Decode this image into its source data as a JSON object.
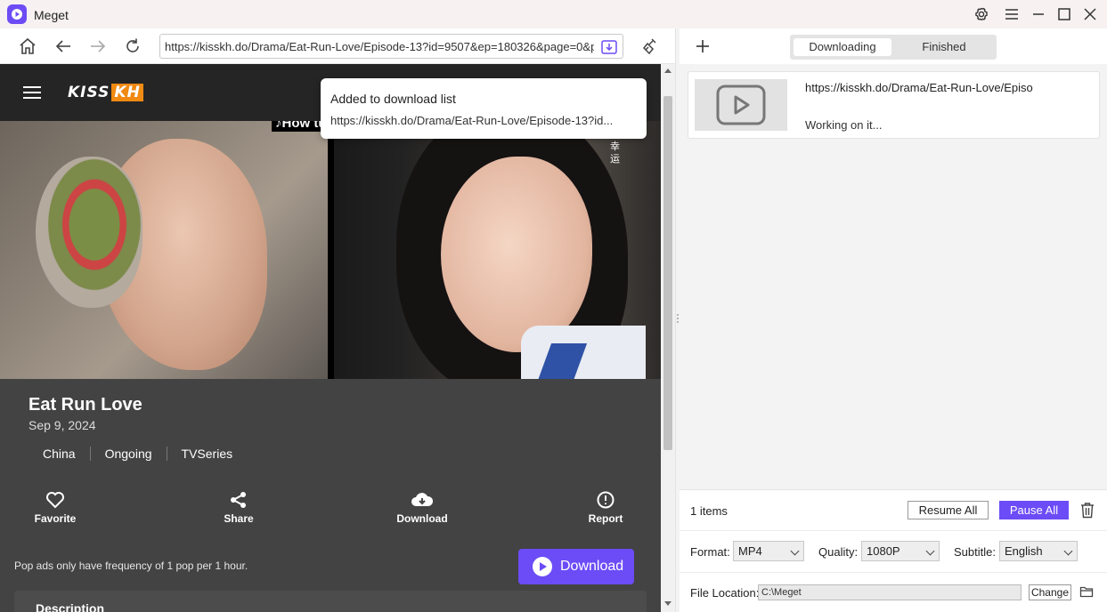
{
  "app": {
    "title": "Meget",
    "accent": "#6b4cf6"
  },
  "titlebar": {
    "icons": [
      "gear-icon",
      "menu-icon",
      "minimize-icon",
      "maximize-icon",
      "close-icon"
    ]
  },
  "browser": {
    "url": "https://kisskh.do/Drama/Eat-Run-Love/Episode-13?id=9507&ep=180326&page=0&pageSize=100",
    "icons": [
      "home-icon",
      "back-icon",
      "forward-icon",
      "refresh-icon",
      "download-page-icon",
      "clean-icon"
    ]
  },
  "site": {
    "logo_kiss": "KISS",
    "logo_kh": "KH",
    "video_subtitle_fragment": "♪How tu",
    "watermark": "幸运",
    "show": {
      "title": "Eat Run Love",
      "date": "Sep 9, 2024",
      "tags": [
        "China",
        "Ongoing",
        "TVSeries"
      ],
      "actions": {
        "favorite": "Favorite",
        "share": "Share",
        "download": "Download",
        "report": "Report"
      },
      "pop_note": "Pop ads only have frequency of 1 pop per 1 hour.",
      "meget_download": "Download",
      "description_title": "Description"
    }
  },
  "toast": {
    "title": "Added to download list",
    "url": "https://kisskh.do/Drama/Eat-Run-Love/Episode-13?id..."
  },
  "panel": {
    "tabs": {
      "downloading": "Downloading",
      "finished": "Finished"
    },
    "item": {
      "url": "https://kisskh.do/Drama/Eat-Run-Love/Episo",
      "status": "Working on it..."
    },
    "items_count": "1 items",
    "resume_all": "Resume All",
    "pause_all": "Pause All",
    "format_label": "Format:",
    "format_value": "MP4",
    "quality_label": "Quality:",
    "quality_value": "1080P",
    "subtitle_label": "Subtitle:",
    "subtitle_value": "English",
    "location_label": "File Location:",
    "location_value": "C:\\Meget",
    "change": "Change"
  }
}
